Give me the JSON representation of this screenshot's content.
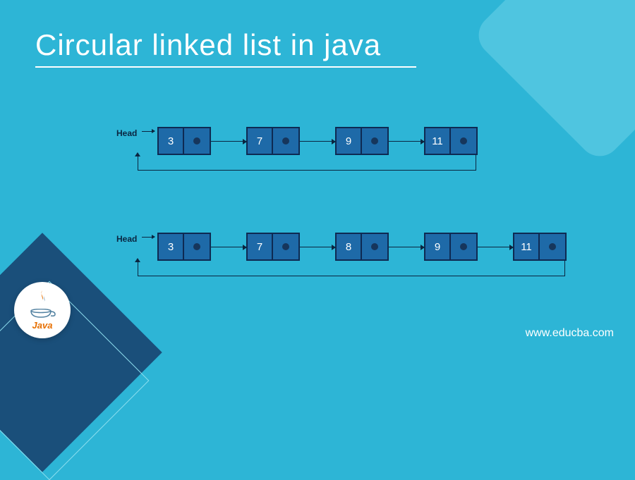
{
  "title": "Circular linked list in java",
  "head_label": "Head",
  "lists": [
    {
      "values": [
        "3",
        "7",
        "9",
        "11"
      ]
    },
    {
      "values": [
        "3",
        "7",
        "8",
        "9",
        "11"
      ]
    }
  ],
  "logo_text": "Java",
  "site_url": "www.educba.com",
  "chart_data": {
    "type": "diagram",
    "description": "Two circular singly linked lists. Each node has a data cell and a pointer cell; the last node's pointer wraps back to the head node.",
    "lists": [
      {
        "name": "list-1",
        "nodes": [
          3,
          7,
          9,
          11
        ],
        "circular": true
      },
      {
        "name": "list-2",
        "nodes": [
          3,
          7,
          8,
          9,
          11
        ],
        "circular": true
      }
    ]
  }
}
